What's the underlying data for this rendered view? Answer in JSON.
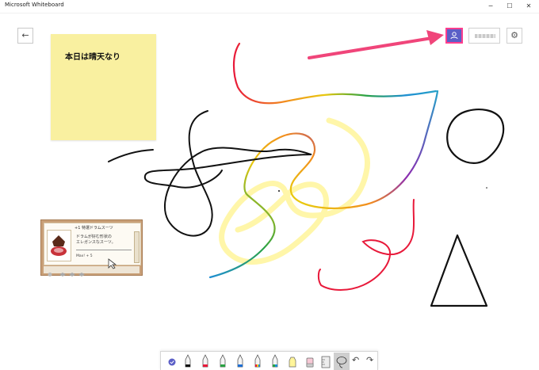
{
  "window": {
    "title": "Microsoft Whiteboard",
    "minimize_glyph": "─",
    "maximize_glyph": "☐",
    "close_glyph": "✕"
  },
  "header": {
    "back_glyph": "←",
    "settings_glyph": "⚙",
    "share_icon": "person-icon"
  },
  "sticky_note": {
    "text": "本日は晴天なり",
    "color": "#f9f0a0"
  },
  "item_card": {
    "title": "+1 特選ドラムスーツ",
    "description_line1": "ドラムが好む形状の",
    "description_line2": "エレガンスなスーツ。",
    "stat": "Max! + 5"
  },
  "toolbar": {
    "undo_glyph": "↶",
    "redo_glyph": "↷"
  },
  "colors": {
    "accent": "#5b5fc7",
    "highlight_border": "#ff3e8d",
    "arrow": "#f0457a",
    "pen_black": "#111111",
    "pen_red": "#e8193a",
    "highlighter_yellow": "#fff59a"
  }
}
